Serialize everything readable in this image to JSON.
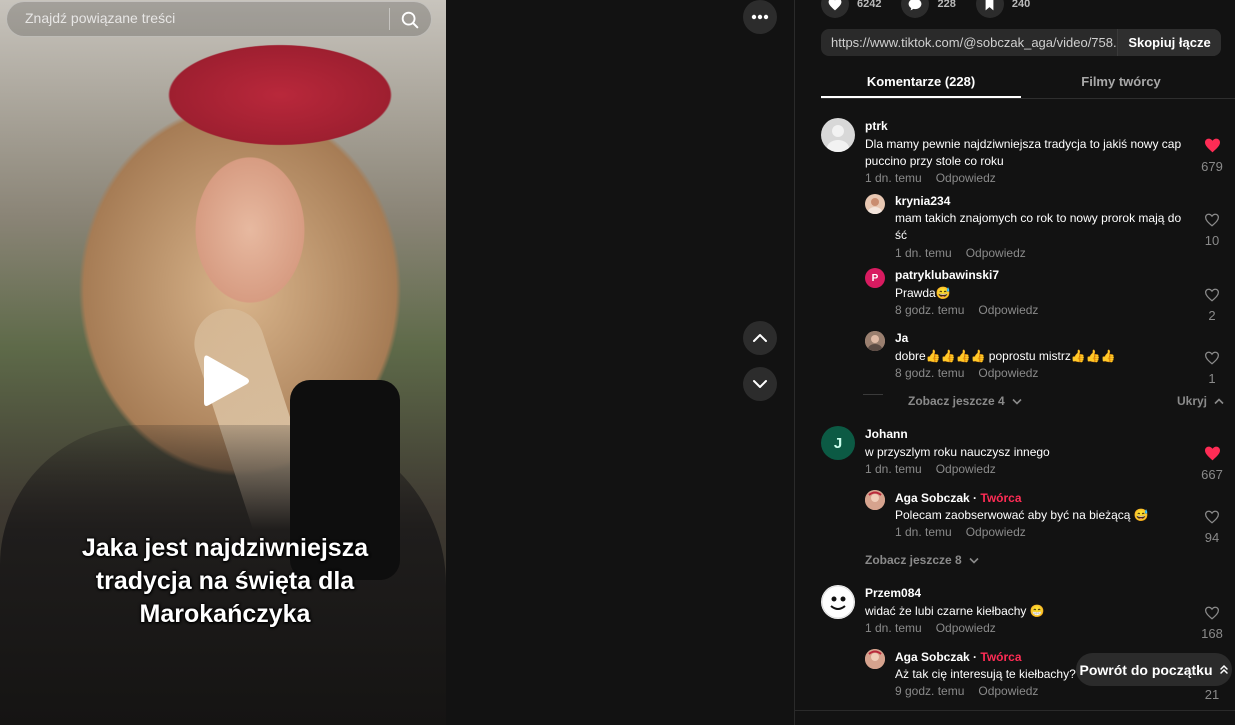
{
  "search": {
    "placeholder": "Znajdź powiązane treści"
  },
  "video": {
    "caption": "Jaka jest najdziwniejsza tradycja na święta dla Marokańczyka"
  },
  "stats": {
    "likes": "6242",
    "comments": "228",
    "saves": "240"
  },
  "share": {
    "url": "https://www.tiktok.com/@sobczak_aga/video/758...",
    "copy_label": "Skopiuj łącze"
  },
  "tabs": {
    "comments": "Komentarze (228)",
    "creator_videos": "Filmy twórcy"
  },
  "labels": {
    "reply": "Odpowiedz",
    "creator_tag": "Twórca",
    "hide": "Ukryj",
    "back_to_top": "Powrót do początku"
  },
  "comments": [
    {
      "user": "ptrk",
      "text": "Dla mamy pewnie najdziwniejsza tradycja to jakiś nowy cap puccino przy stole co roku",
      "time": "1 dn. temu",
      "likes": "679",
      "liked": true
    },
    {
      "user": "krynia234",
      "text": "mam takich znajomych co rok to nowy prorok mają do ść",
      "time": "1 dn. temu",
      "likes": "10",
      "liked": false
    },
    {
      "user": "patryklubawinski7",
      "avatar_letter": "P",
      "text": "Prawda😅",
      "time": "8 godz. temu",
      "likes": "2",
      "liked": false
    },
    {
      "user": "Ja",
      "text": "dobre👍👍👍👍 poprostu mistrz👍👍👍",
      "time": "8 godz. temu",
      "likes": "1",
      "liked": false
    },
    {
      "more": "Zobacz jeszcze 4"
    },
    {
      "user": "Johann",
      "avatar_letter": "J",
      "text": "w przyszlym roku nauczysz innego",
      "time": "1 dn. temu",
      "likes": "667",
      "liked": true
    },
    {
      "user": "Aga Sobczak",
      "text": "Polecam zaobserwować aby być na bieżącą 😅",
      "time": "1 dn. temu",
      "likes": "94",
      "liked": false
    },
    {
      "more": "Zobacz jeszcze 8"
    },
    {
      "user": "Przem084",
      "text": "widać że lubi czarne kiełbachy 😁",
      "time": "1 dn. temu",
      "likes": "168",
      "liked": false
    },
    {
      "user": "Aga Sobczak",
      "text": "Aż tak cię interesują te kiełbachy?",
      "time": "9 godz. temu",
      "likes": "21",
      "liked": false
    }
  ],
  "colors": {
    "accent": "#fe2c55",
    "panel_bg": "#121212",
    "muted": "#8a8a8a"
  }
}
